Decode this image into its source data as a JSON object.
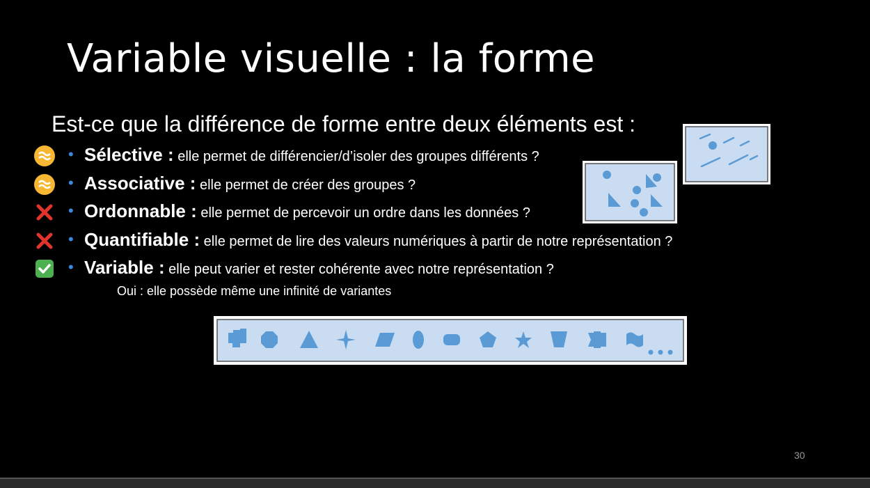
{
  "slide": {
    "title": "Variable visuelle : la forme",
    "question": "Est-ce que la différence de forme entre deux éléments est :",
    "items": [
      {
        "status_icon": "approx-equal-icon",
        "term": "Sélective :",
        "desc": " elle permet de différencier/d’isoler des groupes différents ?"
      },
      {
        "status_icon": "approx-equal-icon",
        "term": "Associative :",
        "desc": " elle permet de créer des groupes ?"
      },
      {
        "status_icon": "cross-mark-icon",
        "term": "Ordonnable :",
        "desc": " elle permet de percevoir un ordre dans les données ?"
      },
      {
        "status_icon": "cross-mark-icon",
        "term": "Quantifiable :",
        "desc": " elle permet de lire des valeurs numériques à partir de notre représentation ?"
      },
      {
        "status_icon": "check-mark-icon",
        "term": "Variable :",
        "desc": " elle peut varier et rester cohérente avec notre représentation ?"
      }
    ],
    "sub_note": "Oui : elle possède même une infinité de variantes",
    "page_number": "30",
    "colors": {
      "background": "#000000",
      "bullet": "#3a8be0",
      "shape_fill": "#5b9bd5",
      "panel_fill": "#c9dcf2"
    }
  }
}
